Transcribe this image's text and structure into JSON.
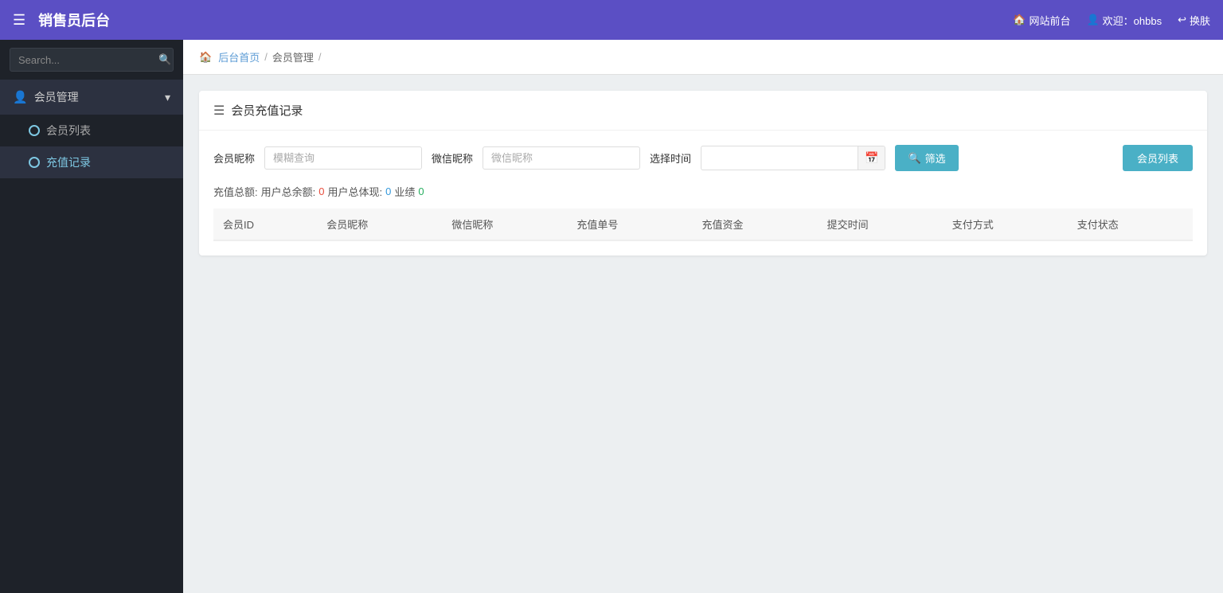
{
  "app": {
    "title": "销售员后台",
    "toggle_icon": "☰"
  },
  "navbar": {
    "website_front": "网站前台",
    "welcome": "欢迎：ohbbs",
    "logout": "换肤",
    "home_icon": "🏠",
    "user_icon": "👤",
    "switch_icon": "↩"
  },
  "sidebar": {
    "search_placeholder": "Search...",
    "menu_items": [
      {
        "label": "会员管理",
        "icon": "user",
        "expanded": true,
        "submenu": [
          {
            "label": "会员列表",
            "active": false
          },
          {
            "label": "充值记录",
            "active": true
          }
        ]
      }
    ]
  },
  "breadcrumb": {
    "home": "后台首页",
    "current": "会员管理",
    "sep": "/"
  },
  "page": {
    "card_title": "会员充值记录",
    "filter": {
      "member_nickname_label": "会员昵称",
      "member_nickname_placeholder": "模糊查询",
      "wechat_nickname_label": "微信昵称",
      "wechat_nickname_placeholder": "微信昵称",
      "date_label": "选择时间",
      "date_placeholder": "",
      "filter_btn": "筛选",
      "member_list_btn": "会员列表"
    },
    "stats": {
      "label": "充值总额:",
      "user_balance_label": "用户总余额:",
      "user_balance_val": "0",
      "user_cash_label": "用户总体现:",
      "user_cash_val": "0",
      "performance_label": "业绩",
      "performance_val": "0"
    },
    "table": {
      "columns": [
        "会员ID",
        "会员昵称",
        "微信昵称",
        "充值单号",
        "充值资金",
        "提交时间",
        "支付方式",
        "支付状态"
      ],
      "rows": []
    }
  }
}
